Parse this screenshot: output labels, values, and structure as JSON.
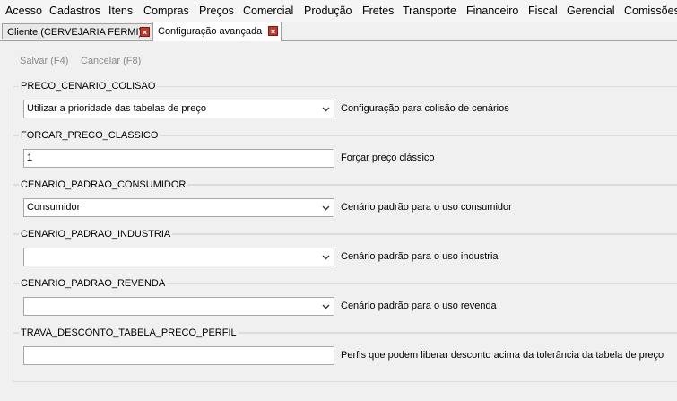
{
  "menu": [
    "Acesso",
    "Cadastros",
    "Itens",
    "Compras",
    "Preços",
    "Comercial",
    "Produção",
    "Fretes",
    "Transporte",
    "Financeiro",
    "Fiscal",
    "Gerencial",
    "Comissões"
  ],
  "tabs": [
    {
      "label": "Cliente (CERVEJARIA FERMI)",
      "active": false
    },
    {
      "label": "Configuração avançada",
      "active": true
    }
  ],
  "toolbar": {
    "save_label": "Salvar (F4)",
    "cancel_label": "Cancelar (F8)"
  },
  "settings": [
    {
      "key": "PRECO_CENARIO_COLISAO",
      "type": "select",
      "value": "Utilizar a prioridade das tabelas de preço",
      "description": "Configuração para colisão de cenários"
    },
    {
      "key": "FORCAR_PRECO_CLASSICO",
      "type": "text",
      "value": "1",
      "description": "Forçar preço clássico"
    },
    {
      "key": "CENARIO_PADRAO_CONSUMIDOR",
      "type": "select",
      "value": "Consumidor",
      "description": "Cenário padrão para o uso consumidor"
    },
    {
      "key": "CENARIO_PADRAO_INDUSTRIA",
      "type": "select",
      "value": "",
      "description": "Cenário padrão para o uso industria"
    },
    {
      "key": "CENARIO_PADRAO_REVENDA",
      "type": "select",
      "value": "",
      "description": "Cenário padrão para o uso revenda"
    },
    {
      "key": "TRAVA_DESCONTO_TABELA_PRECO_PERFIL",
      "type": "text",
      "value": "",
      "description": "Perfis que podem liberar desconto acima da tolerância da tabela de preço"
    }
  ],
  "icons": {
    "close": "close-icon",
    "dropdown": "chevron-down-icon"
  },
  "colors": {
    "close_button": "#c0392b",
    "disabled_text": "#8a8a8a"
  }
}
